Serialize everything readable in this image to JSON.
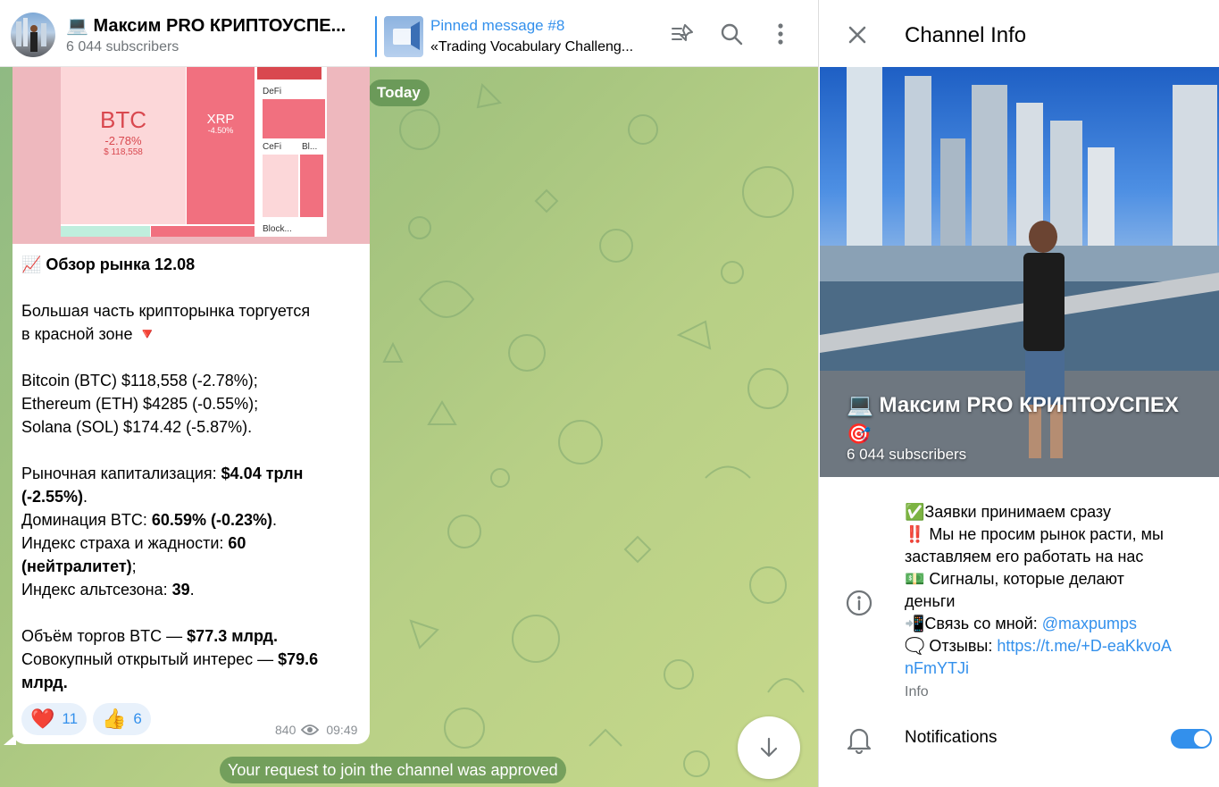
{
  "header": {
    "channel_title": "💻 Максим PRO КРИПТОУСПЕ...",
    "subscribers": "6 044 subscribers",
    "pinned_title": "Pinned message #8",
    "pinned_text": "«Trading Vocabulary Challeng..."
  },
  "chat": {
    "date_label": "Today",
    "service_message": "Your request to join the channel was approved",
    "media_heatmap": {
      "btc_label": "BTC",
      "btc_change": "-2.78%",
      "btc_price": "$ 118,558",
      "xrp_label": "XRP",
      "xrp_change": "-4.50%",
      "defi_label": "DeFi",
      "cefi_label": "CeFi",
      "bl_label": "Bl...",
      "block_label": "Block..."
    },
    "message": {
      "lines": [
        "📈 Обзор рынка 12.08",
        "",
        "Большая часть крипторынка торгуется",
        "в красной зоне 🔻",
        "",
        "Bitcoin (BTC) $118,558 (-2.78%);",
        "Ethereum (ETH) $4285 (-0.55%);",
        "Solana (SOL) $174.42 (-5.87%).",
        ""
      ],
      "cap_prefix": "Рыночная капитализация: ",
      "cap_value": "$4.04 трлн",
      "cap_change": "(-2.55%)",
      "cap_end": ".",
      "dom_prefix": "Доминация BTC: ",
      "dom_value": "60.59% (-0.23%)",
      "dom_end": ".",
      "fear_prefix": "Индекс страха и жадности: ",
      "fear_value": "60",
      "fear_label": "(нейтралитет)",
      "fear_end": ";",
      "alt_prefix": "Индекс альтсезона: ",
      "alt_value": "39",
      "alt_end": ".",
      "vol_prefix": "Объём торгов BTC — ",
      "vol_value": "$77.3 млрд.",
      "oi_prefix": "Совокупный открытый интерес — ",
      "oi_value": "$79.6",
      "oi_value2": "млрд.",
      "reactions": [
        {
          "emoji": "❤️",
          "count": "11"
        },
        {
          "emoji": "👍",
          "count": "6"
        }
      ],
      "views": "840",
      "time": "09:49"
    }
  },
  "panel": {
    "title": "Channel Info",
    "cover_name": "💻 Максим PRO КРИПТОУСПЕХ",
    "cover_emoji": "🎯",
    "cover_subscribers": "6 044 subscribers",
    "description": {
      "l1": "✅Заявки принимаем сразу",
      "l2": "‼️ Мы не просим рынок расти, мы",
      "l3": "заставляем его работать на нас",
      "l4": "💵 Сигналы, которые делают",
      "l5": "деньги",
      "l6_prefix": "📲Связь со мной: ",
      "l6_link": "@maxpumps",
      "l7_prefix": "🗨️ Отзывы: ",
      "l7_link": "https://t.me/+D-eaKkvoA",
      "l8_link": "nFmYTJi"
    },
    "info_caption": "Info",
    "notifications_label": "Notifications",
    "notifications_on": true
  },
  "colors": {
    "accent": "#3390ec",
    "chat_bg_start": "#8fba83",
    "chat_bg_end": "#c7d98b",
    "heatmap_red": "#f1707f"
  }
}
